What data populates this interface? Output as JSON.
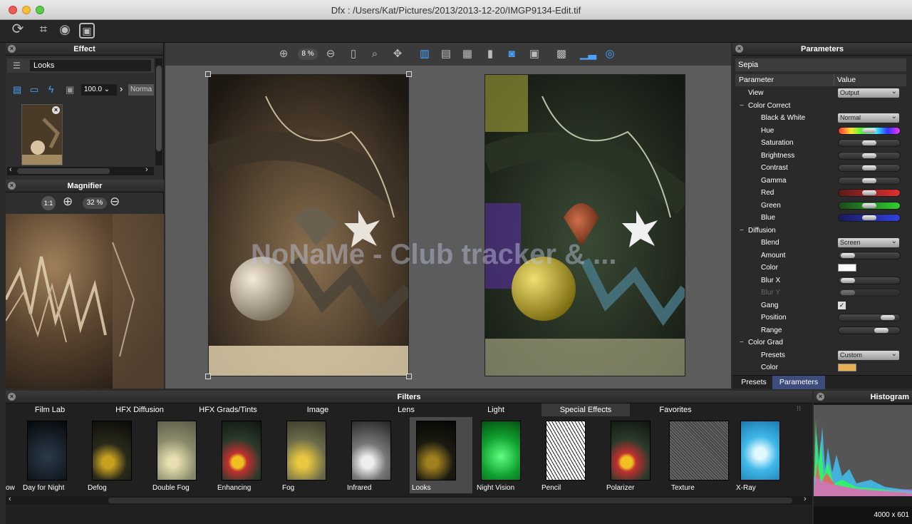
{
  "window": {
    "title": "Dfx : /Users/Kat/Pictures/2013/2013-12-20/IMGP9134-Edit.tif"
  },
  "effect_panel": {
    "title": "Effect",
    "looks_label": "Looks",
    "amount_value": "100.0",
    "blend_value": "Norma"
  },
  "magnifier": {
    "title": "Magnifier",
    "ratio_label": "1:1",
    "zoom": "32 %"
  },
  "canvas": {
    "zoom": "8 %",
    "watermark": "NoNaMe - Club  tracker & ..."
  },
  "parameters_panel": {
    "title": "Parameters",
    "preset_name": "Sepia",
    "col_parameter": "Parameter",
    "col_value": "Value",
    "rows": [
      {
        "label": "View",
        "indent": 1,
        "control": "dropdown",
        "value": "Output"
      },
      {
        "label": "Color Correct",
        "indent": 1,
        "control": "group"
      },
      {
        "label": "Black & White",
        "indent": 2,
        "control": "dropdown",
        "value": "Normal"
      },
      {
        "label": "Hue",
        "indent": 2,
        "control": "slider",
        "track": "hue",
        "level": 0.5
      },
      {
        "label": "Saturation",
        "indent": 2,
        "control": "slider",
        "track": "gray",
        "level": 0.5
      },
      {
        "label": "Brightness",
        "indent": 2,
        "control": "slider",
        "track": "gray",
        "level": 0.5
      },
      {
        "label": "Contrast",
        "indent": 2,
        "control": "slider",
        "track": "gray",
        "level": 0.5
      },
      {
        "label": "Gamma",
        "indent": 2,
        "control": "slider",
        "track": "gray",
        "level": 0.5
      },
      {
        "label": "Red",
        "indent": 2,
        "control": "slider",
        "track": "red",
        "level": 0.5
      },
      {
        "label": "Green",
        "indent": 2,
        "control": "slider",
        "track": "green",
        "level": 0.5
      },
      {
        "label": "Blue",
        "indent": 2,
        "control": "slider",
        "track": "blue",
        "level": 0.5
      },
      {
        "label": "Diffusion",
        "indent": 1,
        "control": "group"
      },
      {
        "label": "Blend",
        "indent": 2,
        "control": "dropdown",
        "value": "Screen"
      },
      {
        "label": "Amount",
        "indent": 2,
        "control": "slider",
        "track": "gray",
        "level": 0.05
      },
      {
        "label": "Color",
        "indent": 2,
        "control": "swatch",
        "color": "#ffffff"
      },
      {
        "label": "Blur X",
        "indent": 2,
        "control": "slider",
        "track": "gray",
        "level": 0.05
      },
      {
        "label": "Blur Y",
        "indent": 2,
        "control": "slider",
        "track": "gray",
        "level": 0.05,
        "disabled": true
      },
      {
        "label": "Gang",
        "indent": 2,
        "control": "checkbox",
        "checked": true
      },
      {
        "label": "Position",
        "indent": 2,
        "control": "slider",
        "track": "gray",
        "level": 0.9
      },
      {
        "label": "Range",
        "indent": 2,
        "control": "slider",
        "track": "gray",
        "level": 0.75
      },
      {
        "label": "Color Grad",
        "indent": 1,
        "control": "group"
      },
      {
        "label": "Presets",
        "indent": 2,
        "control": "dropdown",
        "value": "Custom"
      },
      {
        "label": "Color",
        "indent": 2,
        "control": "swatch",
        "color": "#e8b050"
      }
    ],
    "tab_presets": "Presets",
    "tab_parameters": "Parameters"
  },
  "filters": {
    "title": "Filters",
    "tabs": [
      "Film Lab",
      "HFX Diffusion",
      "HFX Grads/Tints",
      "Image",
      "Lens",
      "Light",
      "Special Effects",
      "Favorites"
    ],
    "active_tab": "Special Effects",
    "items": [
      {
        "name": "ow",
        "style": "rainbow"
      },
      {
        "name": "Day for Night",
        "style": "night"
      },
      {
        "name": "Defog",
        "style": "normal"
      },
      {
        "name": "Double Fog",
        "style": "fog"
      },
      {
        "name": "Enhancing",
        "style": "vivid"
      },
      {
        "name": "Fog",
        "style": "fog2"
      },
      {
        "name": "Infrared",
        "style": "bw"
      },
      {
        "name": "Looks",
        "style": "dark",
        "selected": true
      },
      {
        "name": "Night Vision",
        "style": "green"
      },
      {
        "name": "Pencil",
        "style": "pencil"
      },
      {
        "name": "Polarizer",
        "style": "vivid"
      },
      {
        "name": "Texture",
        "style": "texture"
      },
      {
        "name": "X-Ray",
        "style": "xray"
      }
    ]
  },
  "histogram": {
    "title": "Histogram",
    "dimensions": "4000 x 601"
  },
  "colors": {
    "accent": "#4aa3ff",
    "selection": "#3c4c7c"
  }
}
